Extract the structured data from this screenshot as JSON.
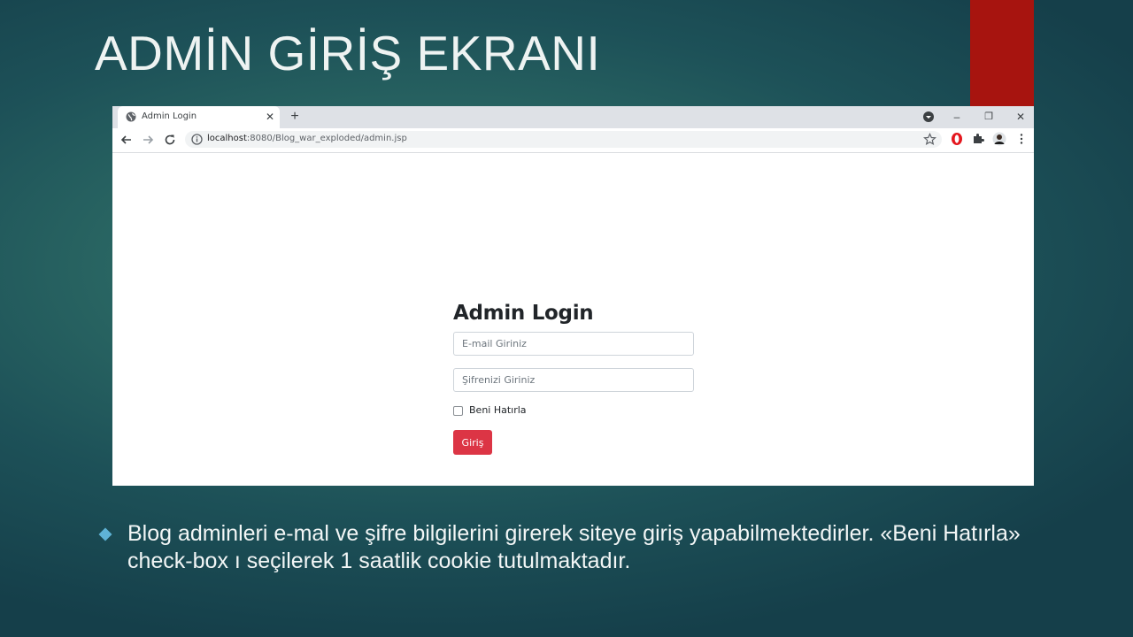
{
  "slide": {
    "title": "ADMİN GİRİŞ EKRANI",
    "bullet": "Blog adminleri e-mal ve şifre bilgilerini girerek siteye giriş yapabilmektedirler. «Beni Hatırla» check-box ı seçilerek 1 saatlik cookie tutulmaktadır.",
    "accent_color": "#a7140f",
    "bullet_color": "#5fb3d6"
  },
  "browser": {
    "tab": {
      "title": "Admin Login",
      "icon": "globe-icon"
    },
    "new_tab_label": "+",
    "close_tab_label": "✕",
    "window_controls": {
      "minimize": "–",
      "restore": "❐",
      "close": "✕"
    },
    "url": {
      "host": "localhost",
      "rest": ":8080/Blog_war_exploded/admin.jsp"
    }
  },
  "login_form": {
    "title": "Admin Login",
    "email_placeholder": "E-mail Giriniz",
    "password_placeholder": "Şifrenizi Giriniz",
    "remember_label": "Beni Hatırla",
    "remember_checked": false,
    "submit_label": "Giriş",
    "submit_color": "#dc3545"
  }
}
